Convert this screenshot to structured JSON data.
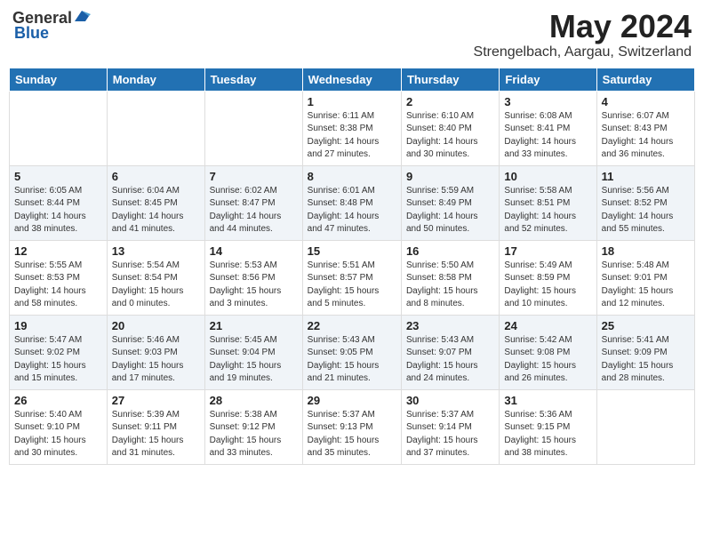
{
  "header": {
    "logo_general": "General",
    "logo_blue": "Blue",
    "title": "May 2024",
    "subtitle": "Strengelbach, Aargau, Switzerland"
  },
  "days_of_week": [
    "Sunday",
    "Monday",
    "Tuesday",
    "Wednesday",
    "Thursday",
    "Friday",
    "Saturday"
  ],
  "weeks": [
    [
      {
        "day": "",
        "info": ""
      },
      {
        "day": "",
        "info": ""
      },
      {
        "day": "",
        "info": ""
      },
      {
        "day": "1",
        "info": "Sunrise: 6:11 AM\nSunset: 8:38 PM\nDaylight: 14 hours\nand 27 minutes."
      },
      {
        "day": "2",
        "info": "Sunrise: 6:10 AM\nSunset: 8:40 PM\nDaylight: 14 hours\nand 30 minutes."
      },
      {
        "day": "3",
        "info": "Sunrise: 6:08 AM\nSunset: 8:41 PM\nDaylight: 14 hours\nand 33 minutes."
      },
      {
        "day": "4",
        "info": "Sunrise: 6:07 AM\nSunset: 8:43 PM\nDaylight: 14 hours\nand 36 minutes."
      }
    ],
    [
      {
        "day": "5",
        "info": "Sunrise: 6:05 AM\nSunset: 8:44 PM\nDaylight: 14 hours\nand 38 minutes."
      },
      {
        "day": "6",
        "info": "Sunrise: 6:04 AM\nSunset: 8:45 PM\nDaylight: 14 hours\nand 41 minutes."
      },
      {
        "day": "7",
        "info": "Sunrise: 6:02 AM\nSunset: 8:47 PM\nDaylight: 14 hours\nand 44 minutes."
      },
      {
        "day": "8",
        "info": "Sunrise: 6:01 AM\nSunset: 8:48 PM\nDaylight: 14 hours\nand 47 minutes."
      },
      {
        "day": "9",
        "info": "Sunrise: 5:59 AM\nSunset: 8:49 PM\nDaylight: 14 hours\nand 50 minutes."
      },
      {
        "day": "10",
        "info": "Sunrise: 5:58 AM\nSunset: 8:51 PM\nDaylight: 14 hours\nand 52 minutes."
      },
      {
        "day": "11",
        "info": "Sunrise: 5:56 AM\nSunset: 8:52 PM\nDaylight: 14 hours\nand 55 minutes."
      }
    ],
    [
      {
        "day": "12",
        "info": "Sunrise: 5:55 AM\nSunset: 8:53 PM\nDaylight: 14 hours\nand 58 minutes."
      },
      {
        "day": "13",
        "info": "Sunrise: 5:54 AM\nSunset: 8:54 PM\nDaylight: 15 hours\nand 0 minutes."
      },
      {
        "day": "14",
        "info": "Sunrise: 5:53 AM\nSunset: 8:56 PM\nDaylight: 15 hours\nand 3 minutes."
      },
      {
        "day": "15",
        "info": "Sunrise: 5:51 AM\nSunset: 8:57 PM\nDaylight: 15 hours\nand 5 minutes."
      },
      {
        "day": "16",
        "info": "Sunrise: 5:50 AM\nSunset: 8:58 PM\nDaylight: 15 hours\nand 8 minutes."
      },
      {
        "day": "17",
        "info": "Sunrise: 5:49 AM\nSunset: 8:59 PM\nDaylight: 15 hours\nand 10 minutes."
      },
      {
        "day": "18",
        "info": "Sunrise: 5:48 AM\nSunset: 9:01 PM\nDaylight: 15 hours\nand 12 minutes."
      }
    ],
    [
      {
        "day": "19",
        "info": "Sunrise: 5:47 AM\nSunset: 9:02 PM\nDaylight: 15 hours\nand 15 minutes."
      },
      {
        "day": "20",
        "info": "Sunrise: 5:46 AM\nSunset: 9:03 PM\nDaylight: 15 hours\nand 17 minutes."
      },
      {
        "day": "21",
        "info": "Sunrise: 5:45 AM\nSunset: 9:04 PM\nDaylight: 15 hours\nand 19 minutes."
      },
      {
        "day": "22",
        "info": "Sunrise: 5:43 AM\nSunset: 9:05 PM\nDaylight: 15 hours\nand 21 minutes."
      },
      {
        "day": "23",
        "info": "Sunrise: 5:43 AM\nSunset: 9:07 PM\nDaylight: 15 hours\nand 24 minutes."
      },
      {
        "day": "24",
        "info": "Sunrise: 5:42 AM\nSunset: 9:08 PM\nDaylight: 15 hours\nand 26 minutes."
      },
      {
        "day": "25",
        "info": "Sunrise: 5:41 AM\nSunset: 9:09 PM\nDaylight: 15 hours\nand 28 minutes."
      }
    ],
    [
      {
        "day": "26",
        "info": "Sunrise: 5:40 AM\nSunset: 9:10 PM\nDaylight: 15 hours\nand 30 minutes."
      },
      {
        "day": "27",
        "info": "Sunrise: 5:39 AM\nSunset: 9:11 PM\nDaylight: 15 hours\nand 31 minutes."
      },
      {
        "day": "28",
        "info": "Sunrise: 5:38 AM\nSunset: 9:12 PM\nDaylight: 15 hours\nand 33 minutes."
      },
      {
        "day": "29",
        "info": "Sunrise: 5:37 AM\nSunset: 9:13 PM\nDaylight: 15 hours\nand 35 minutes."
      },
      {
        "day": "30",
        "info": "Sunrise: 5:37 AM\nSunset: 9:14 PM\nDaylight: 15 hours\nand 37 minutes."
      },
      {
        "day": "31",
        "info": "Sunrise: 5:36 AM\nSunset: 9:15 PM\nDaylight: 15 hours\nand 38 minutes."
      },
      {
        "day": "",
        "info": ""
      }
    ]
  ]
}
